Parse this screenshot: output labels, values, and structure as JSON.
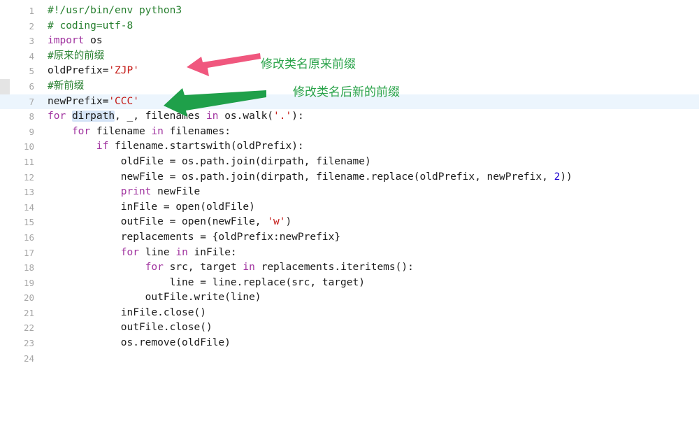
{
  "editor": {
    "language": "python",
    "current_line": 7,
    "selected_token": "dirpath",
    "lines": [
      {
        "n": "1",
        "tokens": [
          {
            "t": "#!/usr/bin/env python3",
            "c": "cm"
          }
        ]
      },
      {
        "n": "2",
        "tokens": [
          {
            "t": "# coding=utf-8",
            "c": "cm"
          }
        ]
      },
      {
        "n": "3",
        "tokens": [
          {
            "t": "import",
            "c": "kw"
          },
          {
            "t": " os",
            "c": ""
          }
        ]
      },
      {
        "n": "4",
        "tokens": [
          {
            "t": "#原来的前缀",
            "c": "cm"
          }
        ]
      },
      {
        "n": "5",
        "tokens": [
          {
            "t": "oldPrefix=",
            "c": ""
          },
          {
            "t": "'ZJP'",
            "c": "str"
          }
        ]
      },
      {
        "n": "6",
        "tokens": [
          {
            "t": "#新前缀",
            "c": "cm"
          }
        ]
      },
      {
        "n": "7",
        "tokens": [
          {
            "t": "newPrefix=",
            "c": ""
          },
          {
            "t": "'CCC'",
            "c": "str"
          }
        ]
      },
      {
        "n": "8",
        "tokens": [
          {
            "t": "for",
            "c": "kw"
          },
          {
            "t": " ",
            "c": ""
          },
          {
            "t": "dirpath",
            "c": "sel"
          },
          {
            "t": ", _, filenames ",
            "c": ""
          },
          {
            "t": "in",
            "c": "kw"
          },
          {
            "t": " os.walk(",
            "c": ""
          },
          {
            "t": "'.'",
            "c": "str"
          },
          {
            "t": "):",
            "c": ""
          }
        ]
      },
      {
        "n": "9",
        "tokens": [
          {
            "t": "    ",
            "c": ""
          },
          {
            "t": "for",
            "c": "kw"
          },
          {
            "t": " filename ",
            "c": ""
          },
          {
            "t": "in",
            "c": "kw"
          },
          {
            "t": " filenames:",
            "c": ""
          }
        ]
      },
      {
        "n": "10",
        "tokens": [
          {
            "t": "        ",
            "c": ""
          },
          {
            "t": "if",
            "c": "kw"
          },
          {
            "t": " filename.startswith(oldPrefix):",
            "c": ""
          }
        ]
      },
      {
        "n": "11",
        "tokens": [
          {
            "t": "            oldFile = os.path.join(dirpath, filename)",
            "c": ""
          }
        ]
      },
      {
        "n": "12",
        "tokens": [
          {
            "t": "            newFile = os.path.join(dirpath, filename.replace(oldPrefix, newPrefix, ",
            "c": ""
          },
          {
            "t": "2",
            "c": "num"
          },
          {
            "t": "))",
            "c": ""
          }
        ]
      },
      {
        "n": "13",
        "tokens": [
          {
            "t": "            ",
            "c": ""
          },
          {
            "t": "print",
            "c": "kw"
          },
          {
            "t": " newFile",
            "c": ""
          }
        ]
      },
      {
        "n": "14",
        "tokens": [
          {
            "t": "            inFile = open(oldFile)",
            "c": ""
          }
        ]
      },
      {
        "n": "15",
        "tokens": [
          {
            "t": "            outFile = open(newFile, ",
            "c": ""
          },
          {
            "t": "'w'",
            "c": "str"
          },
          {
            "t": ")",
            "c": ""
          }
        ]
      },
      {
        "n": "16",
        "tokens": [
          {
            "t": "            replacements = {oldPrefix:newPrefix}",
            "c": ""
          }
        ]
      },
      {
        "n": "17",
        "tokens": [
          {
            "t": "            ",
            "c": ""
          },
          {
            "t": "for",
            "c": "kw"
          },
          {
            "t": " line ",
            "c": ""
          },
          {
            "t": "in",
            "c": "kw"
          },
          {
            "t": " inFile:",
            "c": ""
          }
        ]
      },
      {
        "n": "18",
        "tokens": [
          {
            "t": "                ",
            "c": ""
          },
          {
            "t": "for",
            "c": "kw"
          },
          {
            "t": " src, target ",
            "c": ""
          },
          {
            "t": "in",
            "c": "kw"
          },
          {
            "t": " replacements.iteritems():",
            "c": ""
          }
        ]
      },
      {
        "n": "19",
        "tokens": [
          {
            "t": "                    line = line.replace(src, target)",
            "c": ""
          }
        ]
      },
      {
        "n": "20",
        "tokens": [
          {
            "t": "                outFile.write(line)",
            "c": ""
          }
        ]
      },
      {
        "n": "21",
        "tokens": [
          {
            "t": "            inFile.close()",
            "c": ""
          }
        ]
      },
      {
        "n": "22",
        "tokens": [
          {
            "t": "            outFile.close()",
            "c": ""
          }
        ]
      },
      {
        "n": "23",
        "tokens": [
          {
            "t": "            os.remove(oldFile)",
            "c": ""
          }
        ]
      },
      {
        "n": "24",
        "tokens": []
      }
    ]
  },
  "annotations": {
    "old_prefix_note": {
      "text": "修改类名原来前缀",
      "arrow_color": "#f0577e"
    },
    "new_prefix_note": {
      "text": "修改类名后新的前缀",
      "arrow_color": "#1fa04a"
    }
  }
}
